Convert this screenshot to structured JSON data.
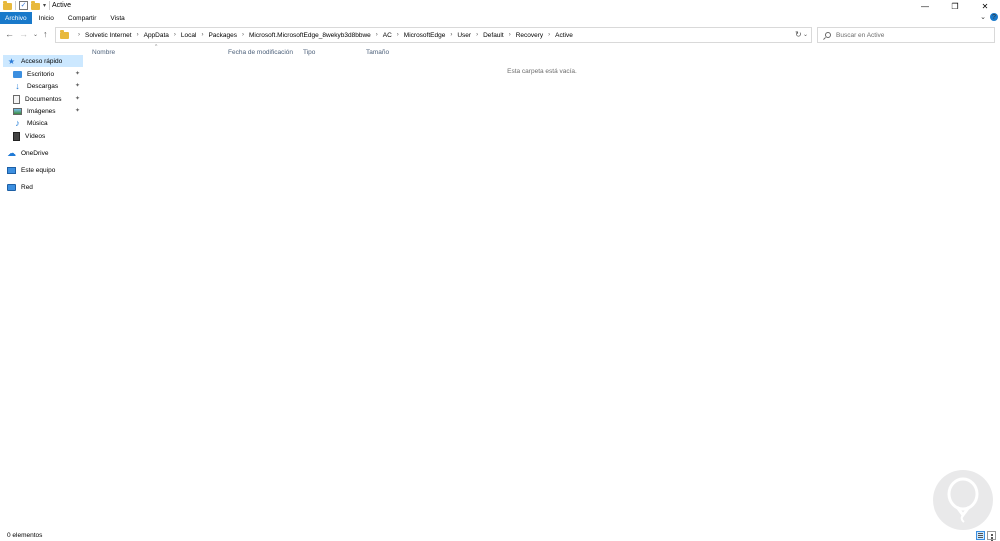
{
  "window": {
    "title": "Active"
  },
  "ribbon": {
    "tabs": [
      "Archivo",
      "Inicio",
      "Compartir",
      "Vista"
    ]
  },
  "address": {
    "crumbs": [
      "Solvetic Internet",
      "AppData",
      "Local",
      "Packages",
      "Microsoft.MicrosoftEdge_8wekyb3d8bbwe",
      "AC",
      "MicrosoftEdge",
      "User",
      "Default",
      "Recovery",
      "Active"
    ]
  },
  "search": {
    "placeholder": "Buscar en Active"
  },
  "nav": {
    "quick_access": "Acceso rápido",
    "items": [
      {
        "label": "Escritorio",
        "icon": "desktop-icon",
        "pinned": true
      },
      {
        "label": "Descargas",
        "icon": "download-icon",
        "pinned": true
      },
      {
        "label": "Documentos",
        "icon": "documents-icon",
        "pinned": true
      },
      {
        "label": "Imágenes",
        "icon": "pictures-icon",
        "pinned": true
      },
      {
        "label": "Música",
        "icon": "music-icon",
        "pinned": false
      },
      {
        "label": "Vídeos",
        "icon": "videos-icon",
        "pinned": false
      }
    ],
    "onedrive": "OneDrive",
    "this_pc": "Este equipo",
    "network": "Red"
  },
  "columns": [
    "Nombre",
    "Fecha de modificación",
    "Tipo",
    "Tamaño"
  ],
  "content": {
    "empty_message": "Esta carpeta está vacía."
  },
  "status": {
    "count": "0 elementos"
  },
  "colors": {
    "accent": "#1979ca",
    "selection": "#cce8ff",
    "folder": "#e8b93c"
  }
}
